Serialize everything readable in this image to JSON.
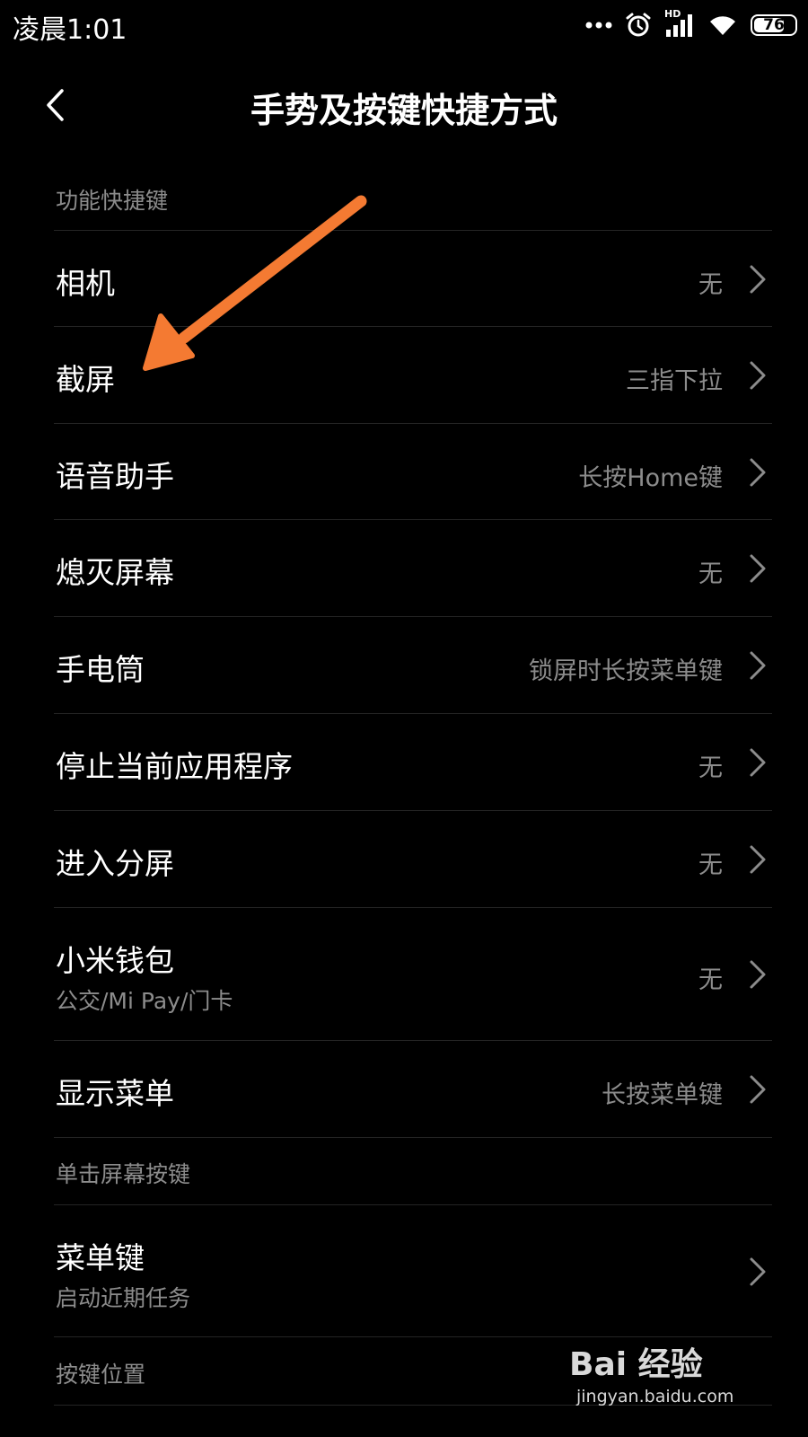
{
  "status_bar": {
    "time": "凌晨1:01",
    "network_label": "HD",
    "battery_level": "76",
    "battery_fraction": 0.76,
    "icons": [
      "more-dots-icon",
      "alarm-icon",
      "hd-signal-icon",
      "wifi-icon",
      "battery-icon"
    ]
  },
  "header": {
    "title": "手势及按键快捷方式",
    "back_icon": "chevron-left-icon"
  },
  "sections": {
    "function_shortcuts": "功能快捷键",
    "tap_screen_keys": "单击屏幕按键",
    "key_position": "按键位置"
  },
  "rows": {
    "camera": {
      "title": "相机",
      "value": "无"
    },
    "screenshot": {
      "title": "截屏",
      "value": "三指下拉"
    },
    "voice_assistant": {
      "title": "语音助手",
      "value": "长按Home键"
    },
    "screen_off": {
      "title": "熄灭屏幕",
      "value": "无"
    },
    "flashlight": {
      "title": "手电筒",
      "value": "锁屏时长按菜单键"
    },
    "stop_app": {
      "title": "停止当前应用程序",
      "value": "无"
    },
    "split_screen": {
      "title": "进入分屏",
      "value": "无"
    },
    "mi_wallet": {
      "title": "小米钱包",
      "subtitle": "公交/Mi Pay/门卡",
      "value": "无"
    },
    "show_menu": {
      "title": "显示菜单",
      "value": "长按菜单键"
    },
    "menu_key": {
      "title": "菜单键",
      "subtitle": "启动近期任务"
    }
  },
  "watermark": {
    "brand": "Bai 经验",
    "url": "jingyan.baidu.com"
  },
  "colors": {
    "background": "#000000",
    "text_primary": "#ffffff",
    "text_secondary": "#8c8c8c",
    "annotation_arrow": "#f47a32"
  }
}
